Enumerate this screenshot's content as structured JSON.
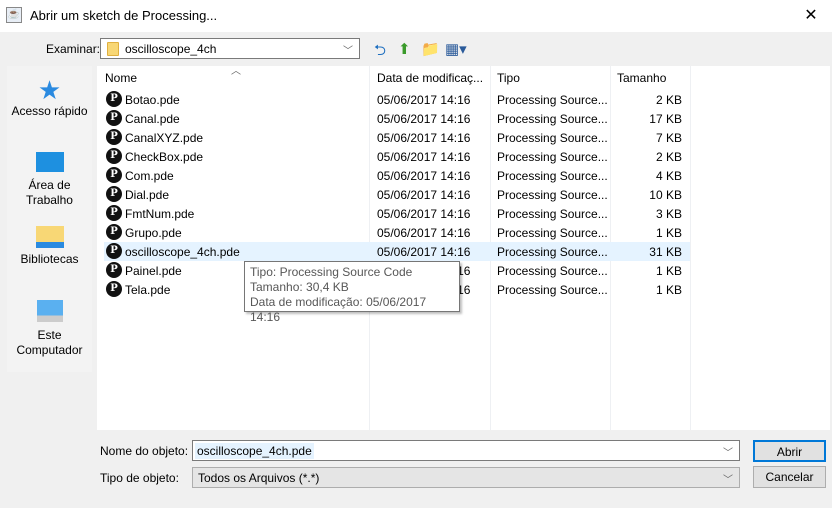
{
  "window": {
    "title": "Abrir um sketch de Processing...",
    "close": "✕"
  },
  "look_in": {
    "label": "Examinar:",
    "value": "oscilloscope_4ch"
  },
  "places": [
    {
      "label": "Acesso rápido",
      "icon": "star-icon"
    },
    {
      "label": "Área de Trabalho",
      "icon": "desktop-icon"
    },
    {
      "label": "Bibliotecas",
      "icon": "libraries-icon"
    },
    {
      "label": "Este Computador",
      "icon": "computer-icon"
    }
  ],
  "columns": {
    "name": "Nome",
    "date": "Data de modificaç...",
    "type": "Tipo",
    "size": "Tamanho"
  },
  "files": [
    {
      "name": "Botao.pde",
      "date": "05/06/2017 14:16",
      "type": "Processing Source...",
      "size": "2 KB"
    },
    {
      "name": "Canal.pde",
      "date": "05/06/2017 14:16",
      "type": "Processing Source...",
      "size": "17 KB"
    },
    {
      "name": "CanalXYZ.pde",
      "date": "05/06/2017 14:16",
      "type": "Processing Source...",
      "size": "7 KB"
    },
    {
      "name": "CheckBox.pde",
      "date": "05/06/2017 14:16",
      "type": "Processing Source...",
      "size": "2 KB"
    },
    {
      "name": "Com.pde",
      "date": "05/06/2017 14:16",
      "type": "Processing Source...",
      "size": "4 KB"
    },
    {
      "name": "Dial.pde",
      "date": "05/06/2017 14:16",
      "type": "Processing Source...",
      "size": "10 KB"
    },
    {
      "name": "FmtNum.pde",
      "date": "05/06/2017 14:16",
      "type": "Processing Source...",
      "size": "3 KB"
    },
    {
      "name": "Grupo.pde",
      "date": "05/06/2017 14:16",
      "type": "Processing Source...",
      "size": "1 KB"
    },
    {
      "name": "oscilloscope_4ch.pde",
      "date": "05/06/2017 14:16",
      "type": "Processing Source...",
      "size": "31 KB"
    },
    {
      "name": "Painel.pde",
      "date": "05/06/2017 14:16",
      "type": "Processing Source...",
      "size": "1 KB"
    },
    {
      "name": "Tela.pde",
      "date": "05/06/2017 14:16",
      "type": "Processing Source...",
      "size": "1 KB"
    }
  ],
  "tooltip": {
    "type": "Tipo: Processing Source Code",
    "size": "Tamanho: 30,4 KB",
    "date": "Data de modificação: 05/06/2017 14:16"
  },
  "filename": {
    "label": "Nome do objeto:",
    "value": "oscilloscope_4ch.pde"
  },
  "filetype": {
    "label": "Tipo de objeto:",
    "value": "Todos os Arquivos (*.*)"
  },
  "buttons": {
    "open": "Abrir",
    "cancel": "Cancelar"
  }
}
